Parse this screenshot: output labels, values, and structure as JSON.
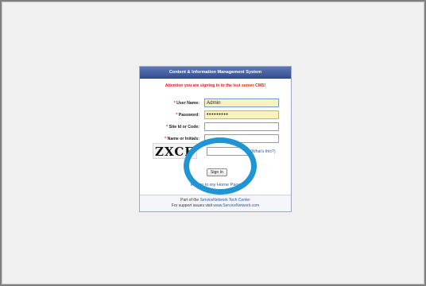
{
  "panel": {
    "title": "Content & Information Management System",
    "warning": "Attention you are signing in to the test server CMS!"
  },
  "form": {
    "username": {
      "label": "User Name:",
      "required_mark": "*",
      "value": "Admin"
    },
    "password": {
      "label": "Password:",
      "required_mark": "*",
      "value": "•••••••••"
    },
    "site_id": {
      "label": "Site Id or Code:",
      "required_mark": "*",
      "value": ""
    },
    "name_initials": {
      "label": "Name or Initials:",
      "required_mark": "*",
      "value": ""
    },
    "captcha": {
      "image_text": "ZXCF",
      "value": "",
      "whats_this": "(What's this?)"
    },
    "signin_label": "Sign In",
    "home_link": "Return to my Home Page"
  },
  "footer": {
    "line1_prefix": "Part of the ",
    "line1_link": "ServiceNetwork Tech Center",
    "line2_prefix": "For support issues visit ",
    "line2_link": "www.ServiceNetwork.com"
  },
  "annotation": {
    "color": "#1f95d4"
  }
}
